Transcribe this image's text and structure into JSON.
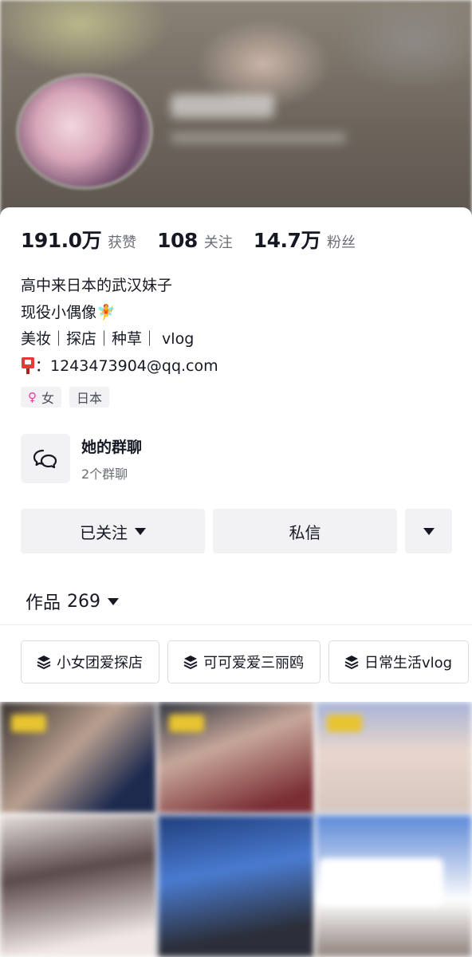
{
  "stats": [
    {
      "value": "191.0万",
      "label": "获赞"
    },
    {
      "value": "108",
      "label": "关注"
    },
    {
      "value": "14.7万",
      "label": "粉丝"
    }
  ],
  "bio": {
    "line1": "高中来日本的武汉妹子",
    "line2": "现役小偶像",
    "line2_emoji": "🧚",
    "line3": "美妆｜探店｜种草｜ vlog",
    "line4": "：1243473904@qq.com"
  },
  "tags": {
    "gender": "女",
    "location": "日本"
  },
  "group_chat": {
    "title": "她的群聊",
    "subtitle": "2个群聊"
  },
  "buttons": {
    "follow": "已关注",
    "message": "私信"
  },
  "works": {
    "label": "作品",
    "count": "269"
  },
  "collections": [
    {
      "label": "小女团爱探店"
    },
    {
      "label": "可可爱爱三丽鸥"
    },
    {
      "label": "日常生活vlog"
    }
  ],
  "colors": {
    "text_primary": "#161823",
    "text_secondary": "#6b6e76",
    "chip_bg": "#f2f2f4",
    "female_pink": "#f0359a"
  }
}
